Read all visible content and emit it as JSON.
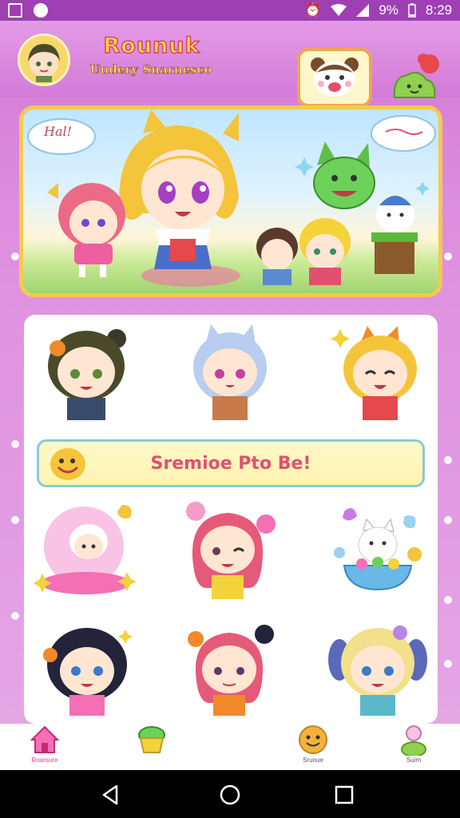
{
  "status_bar": {
    "battery": "9%",
    "time": "8:29"
  },
  "header": {
    "title": "Rounuk",
    "subtitle": "Uudery Snarnesco"
  },
  "banner": {
    "bubble_left": "Hal!"
  },
  "card": {
    "banner_text": "Sremioe Pto Be!"
  },
  "bottom_nav": {
    "items": [
      {
        "label": "Roorsure",
        "icon": "home-icon",
        "active": true
      },
      {
        "label": "",
        "icon": "cupcake-icon",
        "active": false
      },
      {
        "label": "Srunue",
        "icon": "smiley-icon",
        "active": false
      },
      {
        "label": "Suim",
        "icon": "profile-icon",
        "active": false
      }
    ]
  },
  "colors": {
    "accent": "#e43d8f",
    "background": "#d27ad6",
    "status_bar": "#9e3fb4"
  }
}
